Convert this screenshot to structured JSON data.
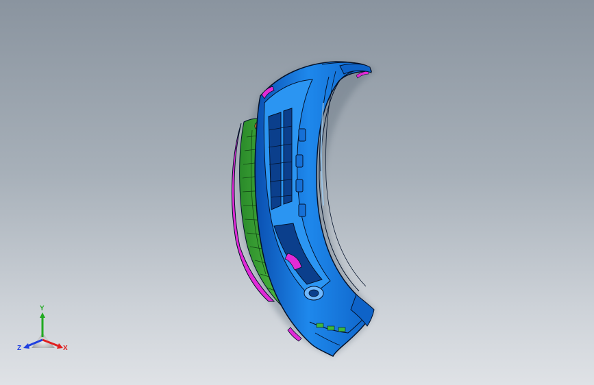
{
  "viewport": {
    "background_top": "#8a949f",
    "background_bottom": "#dfe2e6"
  },
  "model": {
    "part_type": "bumper-shell",
    "colors": {
      "body": "#1e88ec",
      "body_dark": "#0a4fb0",
      "edge": "#04122a",
      "inner_green": "#3fb83a",
      "accent_magenta": "#e12ad6",
      "accent_orange": "#e88a20"
    }
  },
  "triad": {
    "x_label": "X",
    "y_label": "Y",
    "z_label": "Z",
    "x_color": "#e02020",
    "y_color": "#22aa22",
    "z_color": "#2040e0"
  }
}
